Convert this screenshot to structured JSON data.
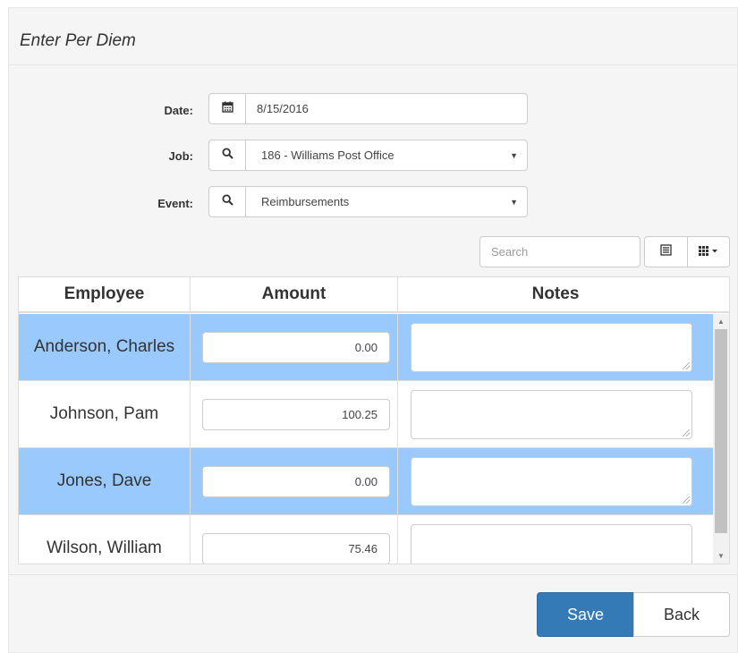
{
  "title": "Enter Per Diem",
  "form": {
    "date": {
      "label": "Date:",
      "value": "8/15/2016",
      "icon": "calendar-icon"
    },
    "job": {
      "label": "Job:",
      "value": "186 - Williams Post Office",
      "icon": "search-icon"
    },
    "event": {
      "label": "Event:",
      "value": "Reimbursements",
      "icon": "search-icon"
    }
  },
  "toolbar": {
    "search_placeholder": "Search"
  },
  "table": {
    "columns": [
      "Employee",
      "Amount",
      "Notes"
    ],
    "rows": [
      {
        "employee": "Anderson, Charles",
        "amount": "0.00",
        "notes": "",
        "selected": true
      },
      {
        "employee": "Johnson, Pam",
        "amount": "100.25",
        "notes": "",
        "selected": false
      },
      {
        "employee": "Jones, Dave",
        "amount": "0.00",
        "notes": "",
        "selected": true
      },
      {
        "employee": "Wilson, William",
        "amount": "75.46",
        "notes": "",
        "selected": false
      }
    ]
  },
  "buttons": {
    "save": "Save",
    "back": "Back"
  },
  "colors": {
    "selected_row": "#99c9fd",
    "primary": "#337ab7"
  }
}
